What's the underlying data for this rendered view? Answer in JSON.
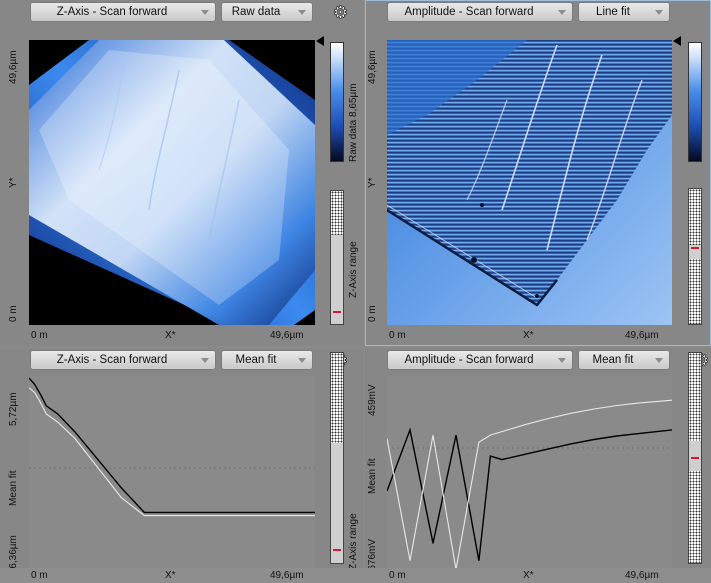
{
  "panels": {
    "top_left": {
      "channel": "Z-Axis - Scan forward",
      "mode": "Raw data",
      "y_top": "49,6µm",
      "y_axis": "Y*",
      "y_bottom": "0 m",
      "x_left": "0 m",
      "x_axis": "X*",
      "x_right": "49,6µm",
      "colorbar_label": "Raw data 8,65µm",
      "range_label": "Z-Axis range",
      "gear_icon": "gear-icon"
    },
    "top_right": {
      "channel": "Amplitude - Scan forward",
      "mode": "Line fit",
      "y_top": "49,6µm",
      "y_axis": "Y*",
      "y_bottom": "0 m",
      "x_left": "0 m",
      "x_axis": "X*",
      "x_right": "49,6µm"
    },
    "bottom_left": {
      "channel": "Z-Axis - Scan forward",
      "mode": "Mean fit",
      "y_top": "5,72µm",
      "y_axis": "Mean fit",
      "y_bottom": "-6,36µm",
      "x_left": "0 m",
      "x_axis": "X*",
      "x_right": "49,6µm",
      "range_label": "Z-Axis range"
    },
    "bottom_right": {
      "channel": "Amplitude - Scan forward",
      "mode": "Mean fit",
      "y_top": "459mV",
      "y_axis": "Mean fit",
      "y_bottom": "-676mV",
      "x_left": "0 m",
      "x_axis": "X*",
      "x_right": "49,6µm"
    }
  },
  "colors": {
    "background": "#8a8a8a",
    "accent_blue": "#2b7fe0",
    "range_marker": "#e0142a",
    "selected_border": "#9bbbd6"
  },
  "chart_data": [
    {
      "type": "line",
      "x": [
        0,
        1,
        2,
        3,
        5,
        8,
        12,
        16,
        20,
        24,
        28,
        32,
        36,
        40,
        44,
        49.6
      ],
      "series": [
        {
          "values": [
            5.6,
            5.2,
            4.6,
            3.9,
            3.4,
            2.3,
            0.6,
            -1.1,
            -2.6,
            -2.6,
            -2.6,
            -2.6,
            -2.6,
            -2.6,
            -2.6,
            -2.6
          ]
        },
        {
          "values": [
            5.0,
            4.7,
            4.1,
            3.4,
            2.9,
            1.9,
            0.1,
            -1.7,
            -2.8,
            -2.8,
            -2.8,
            -2.8,
            -2.8,
            -2.8,
            -2.8,
            -2.8
          ]
        }
      ],
      "xlabel": "X*",
      "ylabel": "Mean fit",
      "xlim": [
        0,
        49.6
      ],
      "ylim": [
        -6.36,
        5.72
      ]
    },
    {
      "type": "line",
      "x": [
        0,
        4,
        8,
        12,
        16,
        18,
        20,
        24,
        28,
        32,
        36,
        40,
        44,
        49.6
      ],
      "series": [
        {
          "values": [
            -200,
            150,
            -500,
            120,
            -600,
            0,
            -20,
            10,
            40,
            70,
            95,
            115,
            130,
            150
          ]
        },
        {
          "values": [
            100,
            -600,
            120,
            -650,
            80,
            120,
            140,
            180,
            215,
            245,
            270,
            290,
            305,
            320
          ]
        }
      ],
      "xlabel": "X*",
      "ylabel": "Mean fit",
      "xlim": [
        0,
        49.6
      ],
      "ylim": [
        -676,
        459
      ]
    }
  ]
}
